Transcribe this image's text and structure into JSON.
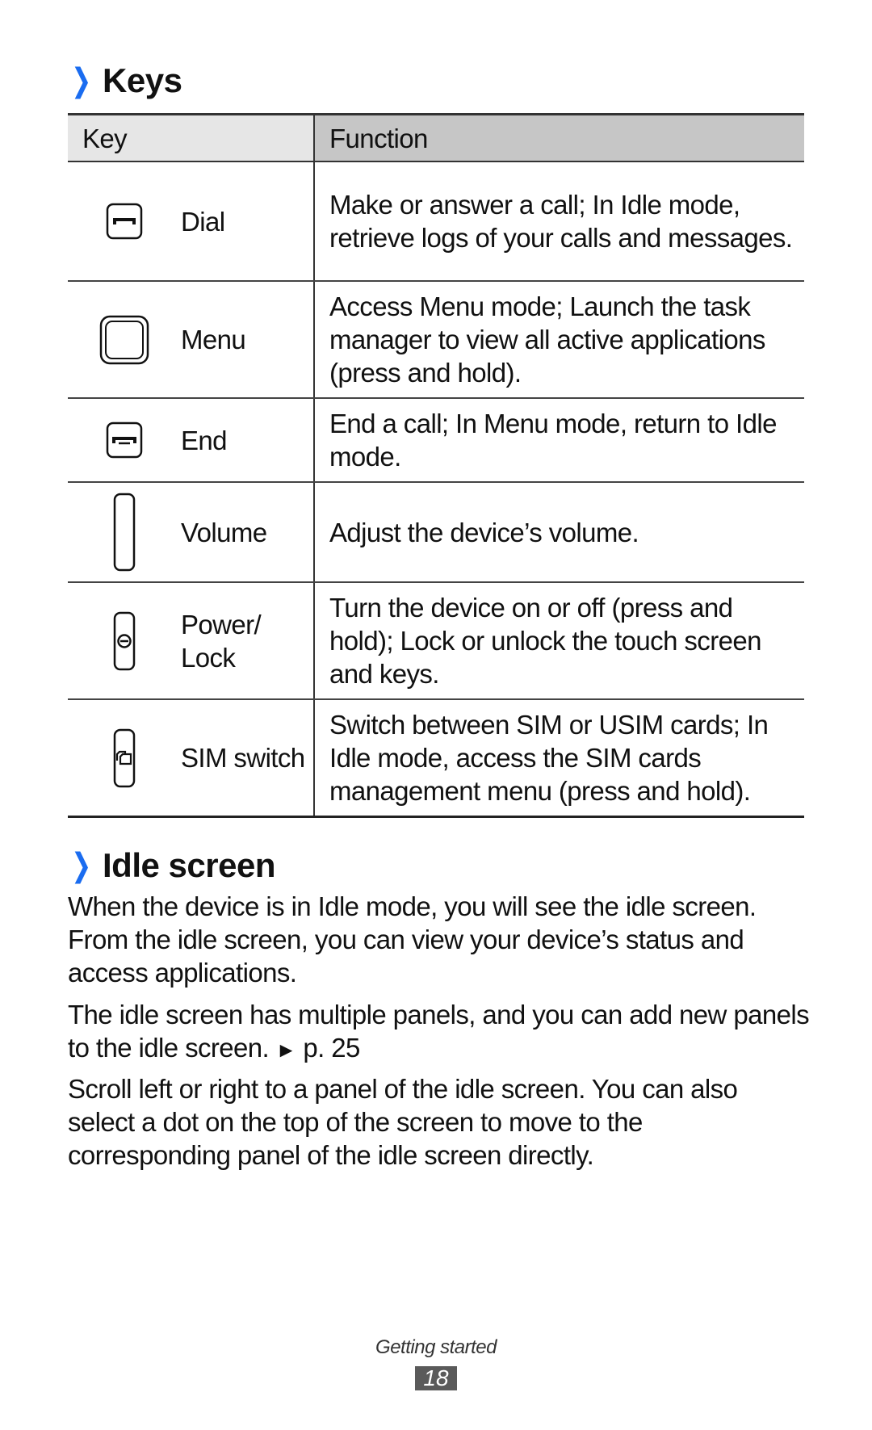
{
  "sections": {
    "keys": {
      "title": "Keys",
      "chevron_icon": "chevron-right-icon"
    },
    "idle": {
      "title": "Idle screen",
      "chevron_icon": "chevron-right-icon"
    }
  },
  "accent_color": "#1a6cf0",
  "table": {
    "headers": {
      "key": "Key",
      "function": "Function"
    },
    "rows": [
      {
        "icon": "dial-key-icon",
        "key": "Dial",
        "function": "Make or answer a call; In Idle mode, retrieve logs of your calls and messages."
      },
      {
        "icon": "menu-key-icon",
        "key": "Menu",
        "function": "Access Menu mode; Launch the task manager to view all active applications (press and hold)."
      },
      {
        "icon": "end-key-icon",
        "key": "End",
        "function": "End a call; In Menu mode, return to Idle mode."
      },
      {
        "icon": "volume-key-icon",
        "key": "Volume",
        "function": "Adjust the device’s volume."
      },
      {
        "icon": "power-lock-key-icon",
        "key": "Power/ Lock",
        "function": "Turn the device on or off (press and hold); Lock or unlock the touch screen and keys."
      },
      {
        "icon": "sim-switch-key-icon",
        "key": "SIM switch",
        "function": "Switch between SIM or USIM cards; In Idle mode, access the SIM cards management menu (press and hold)."
      }
    ]
  },
  "idle_paragraphs": {
    "p1": "When the device is in Idle mode, you will see the idle screen. From the idle screen, you can view your device’s status and access applications.",
    "p2_text": "The idle screen has multiple panels, and you can add new panels to the idle screen.",
    "p2_arrow": "►",
    "p2_ref": "p. 25",
    "p3": "Scroll left or right to a panel of the idle screen. You can also select a dot on the top of the screen to move to the corresponding panel of the idle screen directly."
  },
  "footer": {
    "section": "Getting started",
    "page_number": "18"
  }
}
